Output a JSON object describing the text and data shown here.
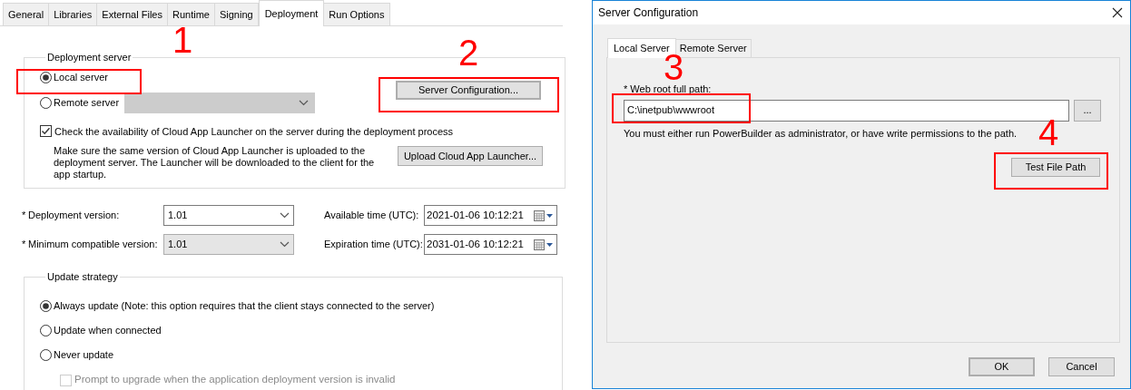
{
  "properties_panel": {
    "tabs": [
      {
        "label": "General",
        "selected": false
      },
      {
        "label": "Libraries",
        "selected": false
      },
      {
        "label": "External Files",
        "selected": false
      },
      {
        "label": "Runtime",
        "selected": false
      },
      {
        "label": "Signing",
        "selected": false
      },
      {
        "label": "Deployment",
        "selected": true
      },
      {
        "label": "Run Options",
        "selected": false
      }
    ],
    "deployment_server": {
      "title": "Deployment server",
      "options": [
        {
          "label": "Local server",
          "selected": true
        },
        {
          "label": "Remote server",
          "selected": false
        }
      ],
      "remote_server_dropdown": {
        "disabled": true
      },
      "server_configuration_button": "Server Configuration...",
      "check_launcher": {
        "label": "Check the availability of Cloud App Launcher on the server during the deployment process",
        "checked": true
      },
      "launcher_note": "Make sure the same version of Cloud App Launcher is uploaded to the deployment server.  The Launcher will be downloaded to the client for the app startup.",
      "upload_button": "Upload Cloud App Launcher..."
    },
    "version_rows": [
      {
        "required_mark": "*",
        "label": "Deployment version:",
        "value": "1.01",
        "disabled": false,
        "time_label": "Available time (UTC):",
        "time_value": "2021-01-06 10:12:21"
      },
      {
        "required_mark": "*",
        "label": "Minimum compatible version:",
        "value": "1.01",
        "disabled": true,
        "time_label": "Expiration time (UTC):",
        "time_value": "2031-01-06 10:12:21"
      }
    ],
    "update_strategy": {
      "title": "Update strategy",
      "options": [
        {
          "label": "Always update (Note: this option requires that the client stays connected to the server)",
          "selected": true
        },
        {
          "label": "Update when connected",
          "selected": false
        },
        {
          "label": "Never update",
          "selected": false
        }
      ],
      "prompt": {
        "label": "Prompt to upgrade when the application deployment version is invalid",
        "checked": false,
        "disabled": true
      }
    }
  },
  "dialog": {
    "title": "Server Configuration",
    "tabs": [
      {
        "label": "Local Server",
        "selected": true
      },
      {
        "label": "Remote Server",
        "selected": false
      }
    ],
    "path_label": "* Web root full path:",
    "path_value": "C:\\inetpub\\wwwroot",
    "browse_button": "...",
    "note": "You must either run PowerBuilder as administrator, or have write permissions to the path.",
    "test_button": "Test File Path",
    "buttons": [
      "OK",
      "Cancel"
    ]
  },
  "annotations": [
    {
      "number": "1"
    },
    {
      "number": "2"
    },
    {
      "number": "3"
    },
    {
      "number": "4"
    }
  ]
}
